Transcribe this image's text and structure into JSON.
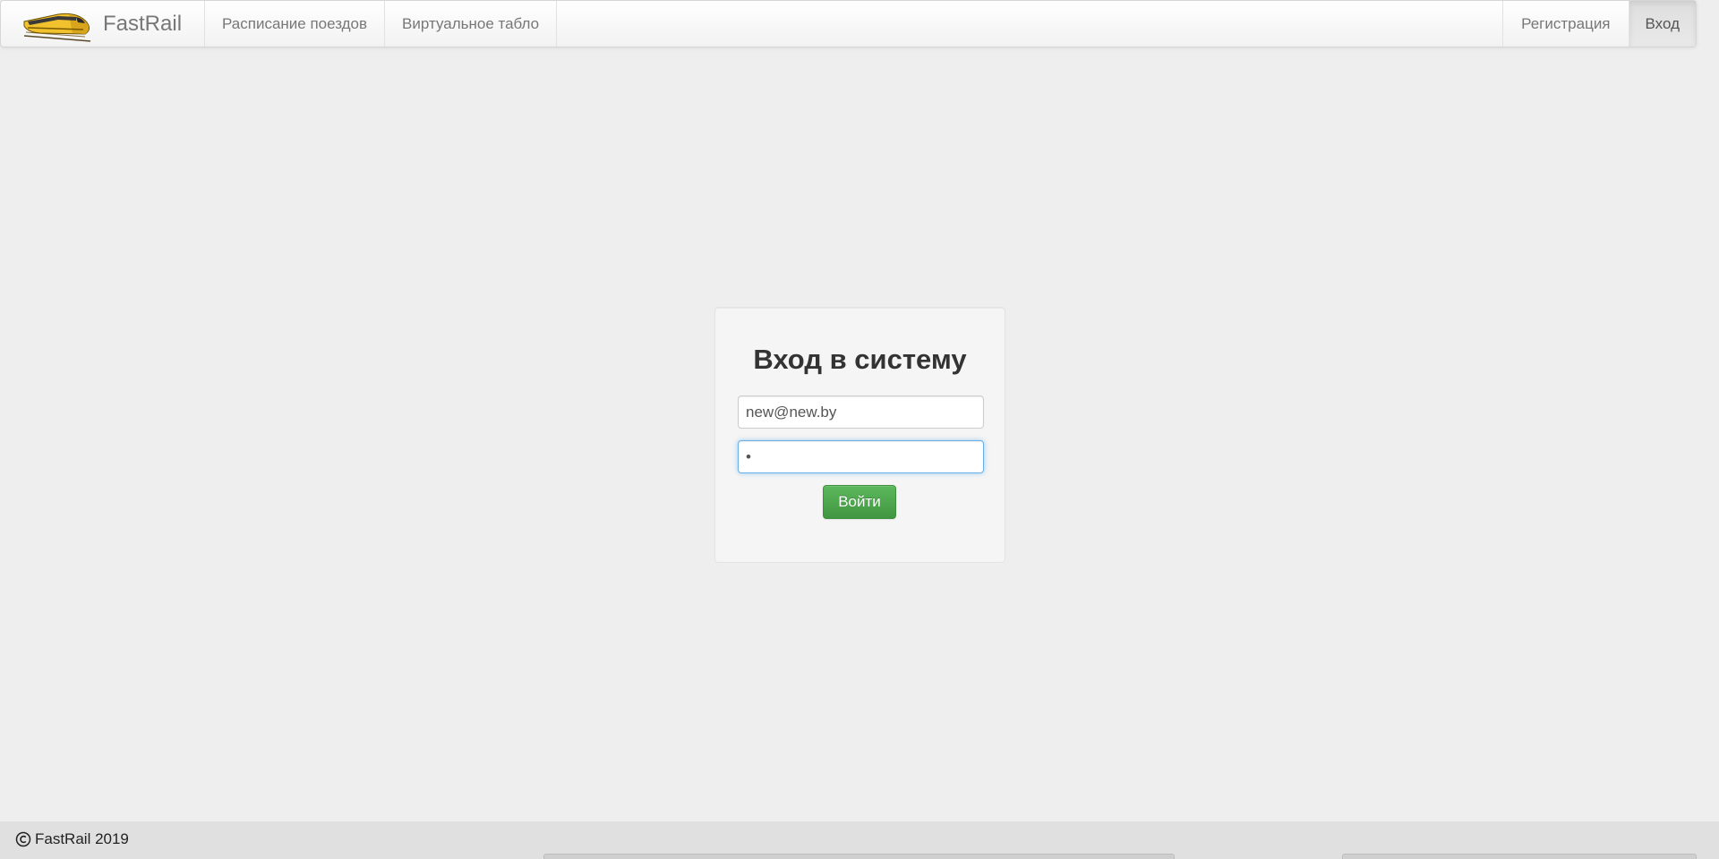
{
  "navbar": {
    "brand": "FastRail",
    "logo_icon": "train-icon",
    "links": [
      {
        "label": "Расписание поездов"
      },
      {
        "label": "Виртуальное табло"
      }
    ],
    "right_links": [
      {
        "label": "Регистрация",
        "active": false
      },
      {
        "label": "Вход",
        "active": true
      }
    ]
  },
  "login": {
    "title": "Вход в систему",
    "email_value": "new@new.by",
    "password_value": "•",
    "submit_label": "Войти"
  },
  "footer": {
    "icon": "copyright-icon",
    "text": "FastRail 2019"
  },
  "colors": {
    "background": "#eeeeee",
    "button_green": "#5cb85c",
    "focus_blue": "#66afe9",
    "logo_yellow": "#f2c12e"
  }
}
